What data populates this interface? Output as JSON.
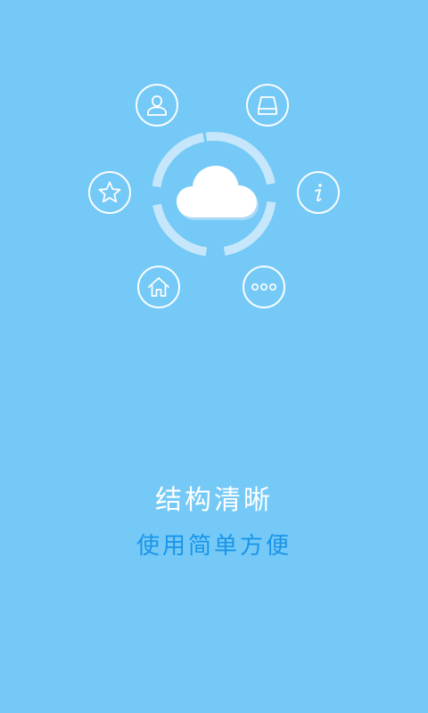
{
  "colors": {
    "background": "#74c9f7",
    "title_text": "#ffffff",
    "subtitle_text": "#1a95e8",
    "cloud": "#ffffff",
    "ring": "#c6e6fb"
  },
  "hero": {
    "center_icon": "cloud-icon",
    "orbit_icons": [
      "user-icon",
      "storage-drive-icon",
      "star-icon",
      "info-icon",
      "home-icon",
      "more-icon"
    ]
  },
  "caption": {
    "title": "结构清晰",
    "subtitle": "使用简单方便"
  }
}
